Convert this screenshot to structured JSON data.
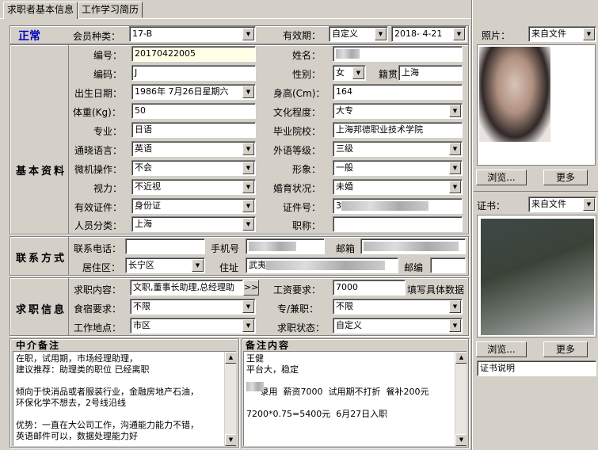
{
  "tabs": [
    "求职者基本信息",
    "工作学习简历"
  ],
  "status": "正常",
  "membership": {
    "label": "会员种类：",
    "value": "17-B"
  },
  "validity": {
    "label": "有效期：",
    "type": "自定义",
    "date": "2018- 4-21"
  },
  "sections": {
    "basic": "基本资料",
    "contact": "联系方式",
    "job": "求职信息"
  },
  "basic": {
    "number_label": "编号：",
    "number": "20170422005",
    "code_label": "编码：",
    "code": "J",
    "birth_label": "出生日期：",
    "birth": "1986年 7月26日星期六",
    "weight_label": "体重(Kg)：",
    "weight": "50",
    "major_label": "专业：",
    "major": "日语",
    "language_label": "通晓语言：",
    "language": "英语",
    "computer_label": "微机操作：",
    "computer": "不会",
    "vision_label": "视力：",
    "vision": "不近视",
    "id_type_label": "有效证件：",
    "id_type": "身份证",
    "category_label": "人员分类：",
    "category": "上海",
    "name_label": "姓名：",
    "name": "",
    "gender_label": "性别：",
    "gender": "女",
    "native_label": "籍贯",
    "native": "上海",
    "height_label": "身高(Cm)：",
    "height": "164",
    "education_label": "文化程度：",
    "education": "大专",
    "school_label": "毕业院校：",
    "school": "上海邦德职业技术学院",
    "lang_level_label": "外语等级：",
    "lang_level": "三级",
    "image_label": "形象：",
    "image": "一般",
    "marital_label": "婚育状况：",
    "marital": "未婚",
    "id_no_label": "证件号：",
    "id_no": "3",
    "title_label": "职称：",
    "title": ""
  },
  "contact": {
    "phone_label": "联系电话：",
    "mobile_label": "手机号",
    "email_label": "邮箱",
    "district_label": "居住区：",
    "district": "长宁区",
    "address_label": "住址",
    "address": "武夷",
    "zip_label": "邮编"
  },
  "job": {
    "position_label": "求职内容：",
    "position": "文职,董事长助理,总经理助",
    "expand": ">>",
    "salary_label": "工资要求：",
    "salary": "7000",
    "salary_note": "填写具体数据",
    "board_label": "食宿要求：",
    "board": "不限",
    "parttime_label": "专/兼职：",
    "parttime": "不限",
    "location_label": "工作地点：",
    "location": "市区",
    "status_label": "求职状态：",
    "status": "自定义"
  },
  "agent_note": {
    "title": "中介备注",
    "text": "在职，试用期，市场经理助理，\n建议推荐：助理类的职位 已经离职\n\n倾向于快消品或者服装行业，金融房地产石油，\n环保化学不想去，2号线沿线\n\n优势：一直在大公司工作，沟通能力能力不错，\n英语邮件可以，数据处理能力好"
  },
  "remark": {
    "title": "备注内容",
    "text": "王健\n平台大，稳定\n\n     录用  薪资7000  试用期不打折  餐补200元\n\n7200*0.75=5400元  6月27日入职"
  },
  "photo": {
    "label": "照片：",
    "source": "来自文件",
    "browse": "浏览...",
    "more": "更多"
  },
  "certificate": {
    "label": "证书：",
    "source": "来自文件",
    "browse": "浏览...",
    "more": "更多",
    "desc": "证书说明"
  }
}
